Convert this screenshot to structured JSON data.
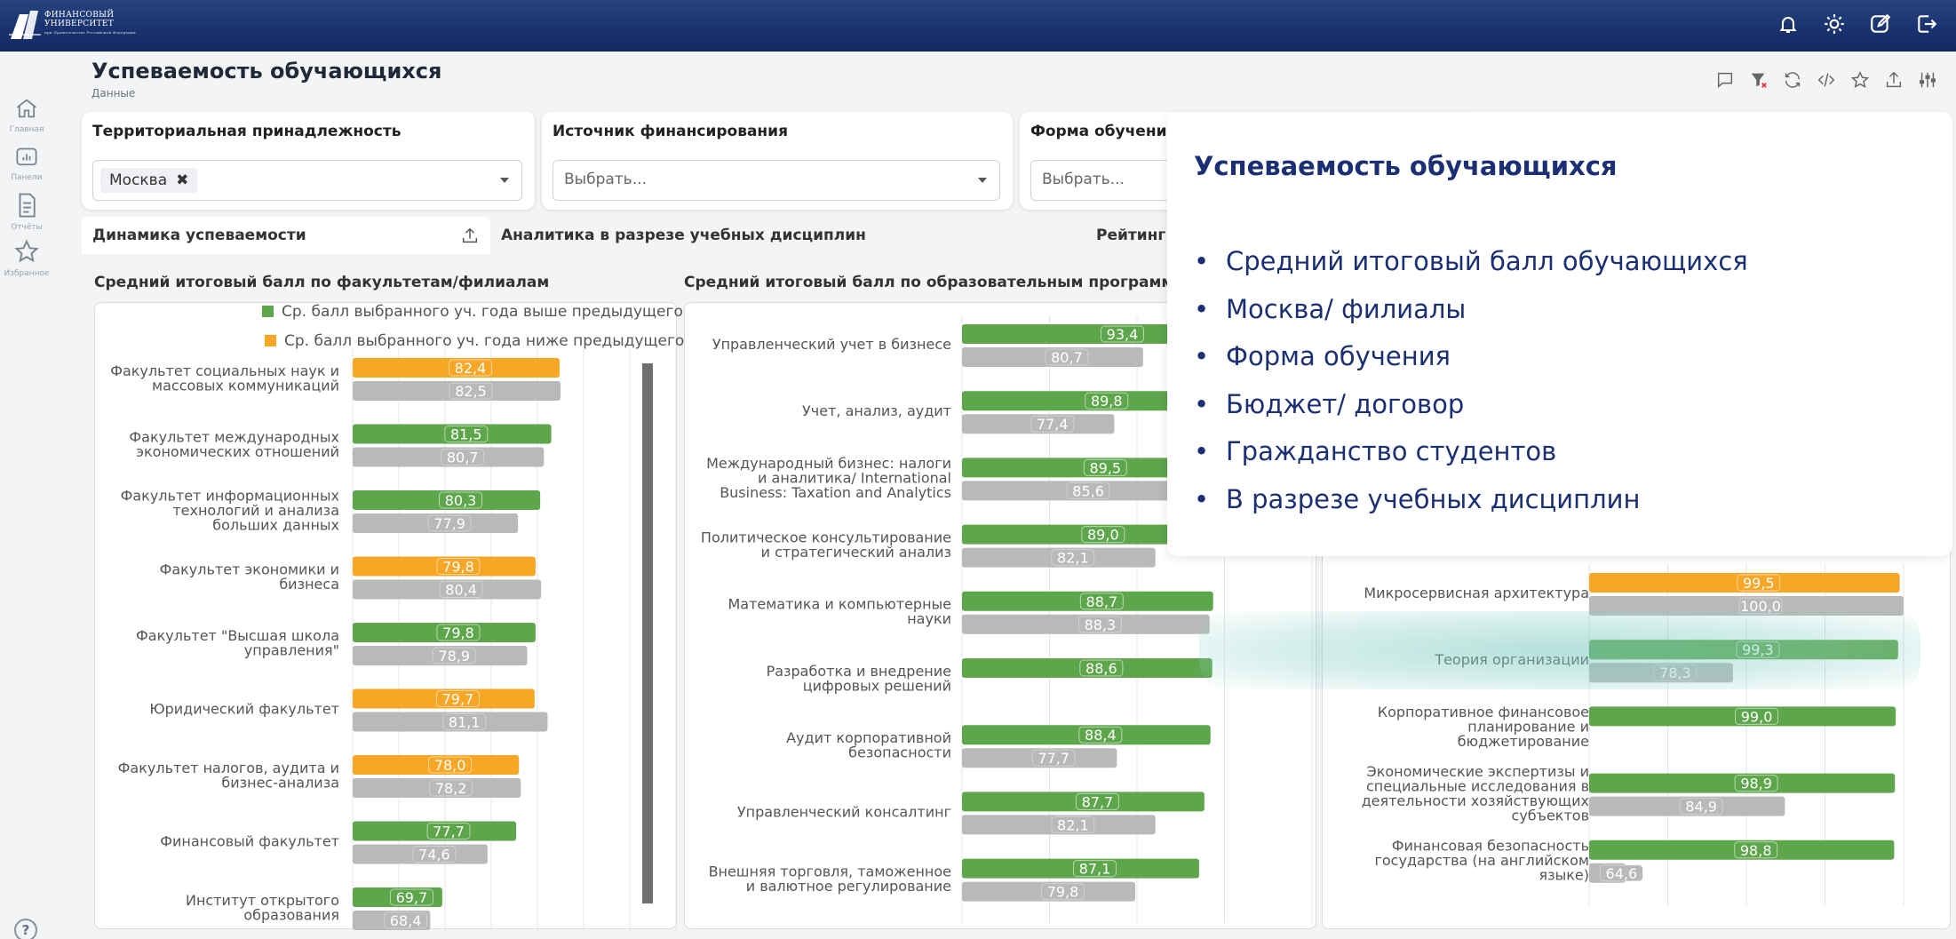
{
  "app": {
    "logo_line1": "ФИНАНСОВЫЙ",
    "logo_line2": "УНИВЕРСИТЕТ",
    "logo_line3": "при Правительстве Российской Федерации",
    "top_icons": [
      "bell-icon",
      "sun-icon",
      "edit-icon",
      "logout-icon"
    ]
  },
  "sidebar": {
    "items": [
      {
        "icon": "home-icon",
        "label": "Главная"
      },
      {
        "icon": "dashboard-icon",
        "label": "Панели"
      },
      {
        "icon": "report-icon",
        "label": "Отчёты"
      },
      {
        "icon": "star-icon",
        "label": "Избранное"
      }
    ],
    "help_label": "?"
  },
  "page": {
    "title": "Успеваемость обучающихся",
    "subtitle": "Данные",
    "tools": [
      "comment-icon",
      "filter-clear-icon",
      "refresh-icon",
      "code-icon",
      "star-icon",
      "share-icon",
      "settings-icon"
    ]
  },
  "filters": [
    {
      "label": "Территориальная принадлежность",
      "chip": "Москва",
      "chip_close": "✖",
      "placeholder": ""
    },
    {
      "label": "Источник финансирования",
      "chip": "",
      "placeholder": "Выбрать..."
    },
    {
      "label": "Форма обучения",
      "chip": "",
      "placeholder": "Выбрать..."
    }
  ],
  "tabs": [
    {
      "label": "Динамика успеваемости",
      "active": true
    },
    {
      "label": "Аналитика в разрезе учебных дисциплин",
      "active": false
    },
    {
      "label": "Рейтинг г",
      "active": false
    }
  ],
  "sections": {
    "faculties": "Средний итоговый балл по факультетам/филиалам",
    "programs": "Средний итоговый балл по образовательным программам"
  },
  "legend": {
    "up": "Ср. балл выбранного уч. года выше предыдущего",
    "down": "Ср. балл выбранного уч. года ниже предыдущего"
  },
  "colors": {
    "green": "#5ea64b",
    "orange": "#f7a626",
    "gray": "#b9b9b9",
    "navy": "#1b2f74"
  },
  "overlay": {
    "title": "Успеваемость обучающихся",
    "items": [
      "Средний итоговый балл обучающихся",
      "Москва/ филиалы",
      "Форма обучения",
      "Бюджет/ договор",
      "Гражданство студентов",
      "В разрезе учебных дисциплин"
    ]
  },
  "chart_data": [
    {
      "type": "bar",
      "orientation": "horizontal",
      "title": "Средний итоговый балл по факультетам/филиалам",
      "categories": [
        "Факультет социальных наук и массовых коммуникаций",
        "Факультет международных экономических отношений",
        "Факультет информационных технологий и анализа больших данных",
        "Факультет экономики и бизнеса",
        "Факультет \"Высшая школа управления\"",
        "Юридический факультет",
        "Факультет налогов, аудита и бизнес-анализа",
        "Финансовый факультет",
        "Институт открытого образования"
      ],
      "label_lines": [
        [
          "Факультет социальных наук и",
          "массовых коммуникаций"
        ],
        [
          "Факультет международных",
          "экономических отношений"
        ],
        [
          "Факультет информационных",
          "технологий и анализа",
          "больших данных"
        ],
        [
          "Факультет экономики и",
          "бизнеса"
        ],
        [
          "Факультет \"Высшая школа",
          "управления\""
        ],
        [
          "Юридический факультет"
        ],
        [
          "Факультет налогов, аудита и",
          "бизнес-анализа"
        ],
        [
          "Финансовый факультет"
        ],
        [
          "Институт открытого",
          "образования"
        ]
      ],
      "series": [
        {
          "values": [
            82.4,
            81.5,
            80.3,
            79.8,
            79.8,
            79.7,
            78.0,
            77.7,
            69.7
          ],
          "labels": [
            "82,4",
            "81,5",
            "80,3",
            "79,8",
            "79,8",
            "79,7",
            "78,0",
            "77,7",
            "69,7"
          ],
          "colors": [
            "orange",
            "green",
            "green",
            "orange",
            "green",
            "orange",
            "orange",
            "green",
            "green"
          ]
        },
        {
          "values": [
            82.5,
            80.7,
            77.9,
            80.4,
            78.9,
            81.1,
            78.2,
            74.6,
            68.4
          ],
          "labels": [
            "82,5",
            "80,7",
            "77,9",
            "80,4",
            "78,9",
            "81,1",
            "78,2",
            "74,6",
            "68,4"
          ],
          "colors": [
            "gray",
            "gray",
            "gray",
            "gray",
            "gray",
            "gray",
            "gray",
            "gray",
            "gray"
          ]
        }
      ]
    },
    {
      "type": "bar",
      "orientation": "horizontal",
      "title": "Средний итоговый балл по образовательным программам",
      "categories": [
        "Управленческий учет в бизнесе",
        "Учет, анализ, аудит",
        "Международный бизнес: налоги и аналитика/ International Business: Taxation and Analytics",
        "Политическое консультирование и стратегический анализ",
        "Математика и компьютерные науки",
        "Разработка и внедрение цифровых решений",
        "Аудит корпоративной безопасности",
        "Управленческий консалтинг",
        "Внешняя торговля, таможенное и валютное регулирование"
      ],
      "label_lines": [
        [
          "Управленческий учет в бизнесе"
        ],
        [
          "Учет, анализ, аудит"
        ],
        [
          "Международный бизнес: налоги",
          "и аналитика/ International",
          "Business: Taxation and Analytics"
        ],
        [
          "Политическое консультирование",
          "и стратегический анализ"
        ],
        [
          "Математика и компьютерные",
          "науки"
        ],
        [
          "Разработка и внедрение",
          "цифровых решений"
        ],
        [
          "Аудит корпоративной",
          "безопасности"
        ],
        [
          "Управленческий консалтинг"
        ],
        [
          "Внешняя торговля, таможенное",
          "и валютное регулирование"
        ]
      ],
      "series": [
        {
          "values": [
            93.4,
            89.8,
            89.5,
            89.0,
            88.7,
            88.6,
            88.4,
            87.7,
            87.1
          ],
          "labels": [
            "93,4",
            "89,8",
            "89,5",
            "89,0",
            "88,7",
            "88,6",
            "88,4",
            "87,7",
            "87,1"
          ],
          "colors": [
            "green",
            "green",
            "green",
            "green",
            "green",
            "green",
            "green",
            "green",
            "green"
          ]
        },
        {
          "values": [
            80.7,
            77.4,
            85.6,
            82.1,
            88.3,
            null,
            77.7,
            82.1,
            79.8
          ],
          "labels": [
            "80,7",
            "77,4",
            "85,6",
            "82,1",
            "88,3",
            "",
            "77,7",
            "82,1",
            "79,8"
          ],
          "colors": [
            "gray",
            "gray",
            "gray",
            "gray",
            "gray",
            "gray",
            "gray",
            "gray",
            "gray"
          ]
        }
      ]
    },
    {
      "type": "bar",
      "orientation": "horizontal",
      "title": "",
      "categories": [
        "Микросервисная архитектура",
        "Теория организации",
        "Корпоративное финансовое планирование и бюджетирование",
        "Экономические экспертизы и специальные исследования в деятельности хозяйствующих субъектов",
        "Финансовая безопасность государства (на английском языке)"
      ],
      "label_lines": [
        [
          "Микросервисная архитектура"
        ],
        [
          "Теория организации"
        ],
        [
          "Корпоративное финансовое",
          "планирование и",
          "бюджетирование"
        ],
        [
          "Экономические экспертизы и",
          "специальные исследования в",
          "деятельности хозяйствующих",
          "субъектов"
        ],
        [
          "Финансовая безопасность",
          "государства (на английском",
          "языке)"
        ]
      ],
      "series": [
        {
          "values": [
            99.5,
            99.3,
            99.0,
            98.9,
            98.8
          ],
          "labels": [
            "99,5",
            "99,3",
            "99,0",
            "98,9",
            "98,8"
          ],
          "colors": [
            "orange",
            "green",
            "green",
            "green",
            "green"
          ]
        },
        {
          "values": [
            100.0,
            78.3,
            null,
            84.9,
            64.6
          ],
          "labels": [
            "100,0",
            "78,3",
            "",
            "84,9",
            "64,6"
          ],
          "colors": [
            "gray",
            "gray",
            "gray",
            "gray",
            "gray"
          ]
        }
      ]
    }
  ]
}
